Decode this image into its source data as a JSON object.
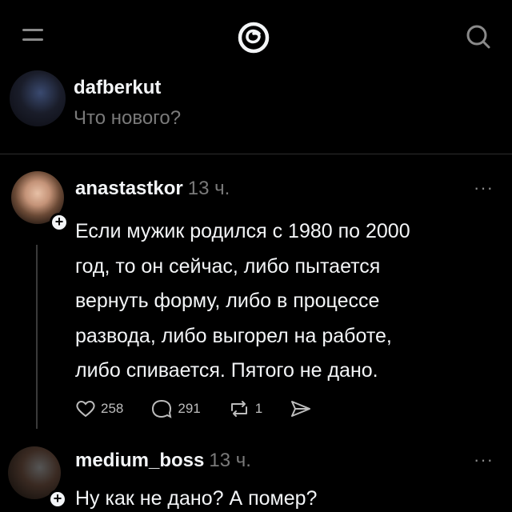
{
  "composer": {
    "username": "dafberkut",
    "prompt": "Что нового?"
  },
  "posts": [
    {
      "handle": "anastastkor",
      "time": "13 ч.",
      "lines": [
        "Если мужик родился с 1980 по 2000",
        "год, то он сейчас, либо пытается",
        "вернуть форму, либо в процессе",
        "развода, либо выгорел на работе,",
        "либо спивается. Пятого не дано."
      ],
      "likes": "258",
      "replies": "291",
      "reposts": "1"
    },
    {
      "handle": "medium_boss",
      "time": "13 ч.",
      "lines": [
        "Ну как не дано? А помер?"
      ]
    }
  ],
  "icons": {
    "menu": "menu-icon",
    "logo": "threads-logo-icon",
    "search": "search-icon",
    "more": "more-icon",
    "like": "heart-icon",
    "reply": "comment-icon",
    "repost": "repost-icon",
    "share": "send-icon",
    "follow": "plus-icon"
  }
}
